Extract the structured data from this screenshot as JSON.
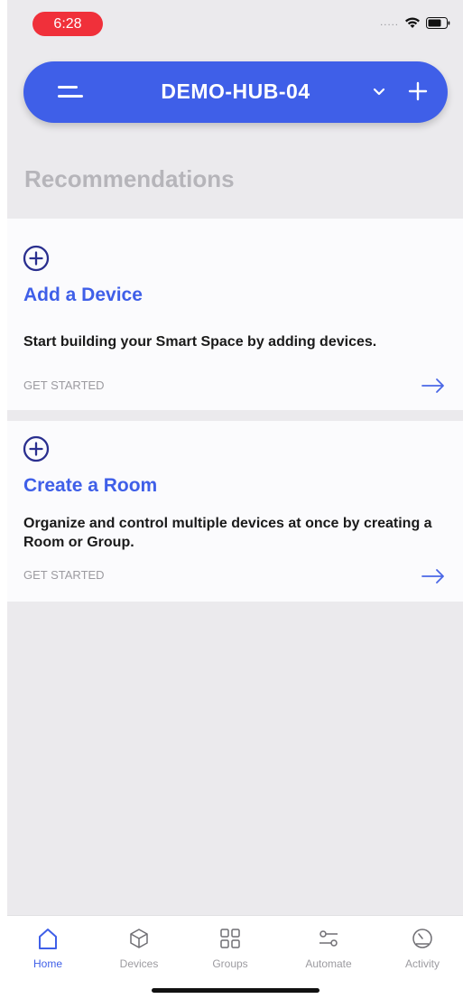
{
  "status_bar": {
    "time": "6:28",
    "signal": "....."
  },
  "header": {
    "hub_name": "DEMO-HUB-04",
    "accent_color": "#3f5fe8"
  },
  "recommendations": {
    "heading": "Recommendations",
    "cards": [
      {
        "icon": "circle-plus-icon",
        "title": "Add a Device",
        "description": "Start building your Smart Space by adding devices.",
        "cta": "GET STARTED"
      },
      {
        "icon": "circle-plus-icon",
        "title": "Create a Room",
        "description": "Organize and control multiple devices at once by creating a Room or Group.",
        "cta": "GET STARTED"
      }
    ]
  },
  "tabs": [
    {
      "label": "Home",
      "icon": "home-icon",
      "active": true
    },
    {
      "label": "Devices",
      "icon": "cube-icon",
      "active": false
    },
    {
      "label": "Groups",
      "icon": "grid-icon",
      "active": false
    },
    {
      "label": "Automate",
      "icon": "sliders-icon",
      "active": false
    },
    {
      "label": "Activity",
      "icon": "gauge-icon",
      "active": false
    }
  ]
}
